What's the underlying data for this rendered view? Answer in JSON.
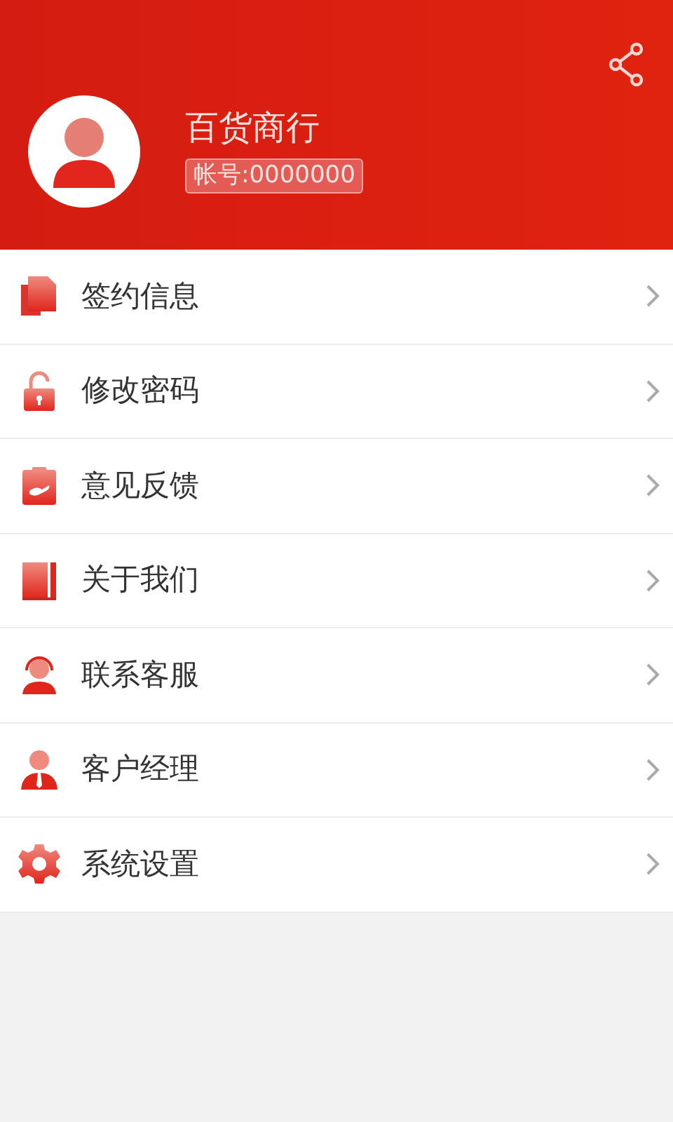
{
  "profile": {
    "name": "百货商行",
    "account": "帐号:0000000"
  },
  "menu": [
    {
      "kind": "documents",
      "label": "签约信息"
    },
    {
      "kind": "lock",
      "label": "修改密码"
    },
    {
      "kind": "feedback",
      "label": "意见反馈"
    },
    {
      "kind": "book",
      "label": "关于我们"
    },
    {
      "kind": "headset",
      "label": "联系客服"
    },
    {
      "kind": "manager",
      "label": "客户经理"
    },
    {
      "kind": "gear",
      "label": "系统设置"
    }
  ]
}
